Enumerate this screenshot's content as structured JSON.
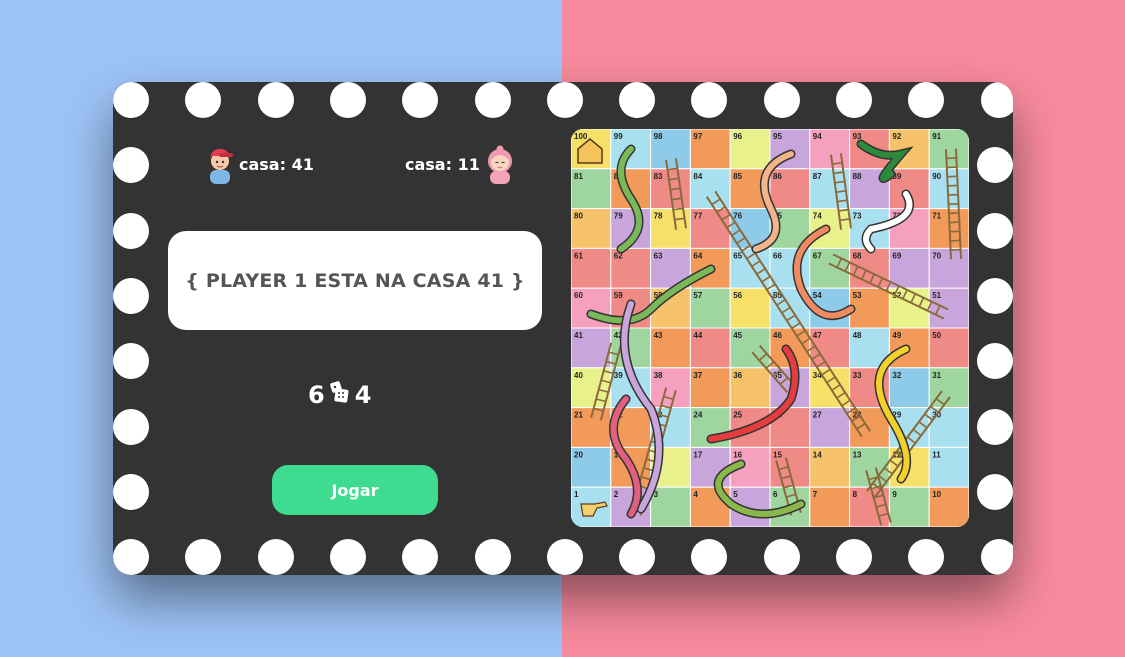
{
  "players": [
    {
      "label": "casa: 41",
      "avatar": "boy-avatar-icon",
      "shirt": "#7fb6e8",
      "cap": "#e53d4f"
    },
    {
      "label": "casa: 11",
      "avatar": "girl-avatar-icon",
      "shirt": "#f3a3b5",
      "hair": "#f09ab0"
    }
  ],
  "status_text": "{ PLAYER 1 ESTA NA CASA 41 }",
  "dice": {
    "left_value": "6",
    "right_value": "4",
    "icon": "dice-icon"
  },
  "play_button_label": "Jogar",
  "colors": {
    "left_background": "#9ec4f7",
    "right_background": "#f98b9e",
    "card": "#333333",
    "button": "#3ddc91"
  },
  "board": {
    "numbers": [
      100,
      99,
      98,
      97,
      96,
      95,
      94,
      93,
      92,
      91,
      81,
      82,
      83,
      84,
      85,
      86,
      87,
      88,
      89,
      90,
      80,
      79,
      78,
      77,
      76,
      75,
      74,
      73,
      72,
      71,
      61,
      62,
      63,
      64,
      65,
      66,
      67,
      68,
      69,
      70,
      60,
      59,
      58,
      57,
      56,
      55,
      54,
      53,
      52,
      51,
      41,
      42,
      43,
      44,
      45,
      46,
      47,
      48,
      49,
      50,
      40,
      39,
      38,
      37,
      36,
      35,
      34,
      33,
      32,
      31,
      21,
      22,
      23,
      24,
      25,
      26,
      27,
      28,
      29,
      30,
      20,
      19,
      18,
      17,
      16,
      15,
      14,
      13,
      12,
      11,
      1,
      2,
      3,
      4,
      5,
      6,
      7,
      8,
      9,
      10
    ],
    "palette": [
      "#f7e06a",
      "#f29a5a",
      "#f6a0c0",
      "#9fd6a0",
      "#8ecbe8",
      "#c8a6dc",
      "#f6c36a",
      "#a8e0f0",
      "#e9f28a",
      "#f08a86"
    ],
    "home_icon": "house-icon",
    "start_icon": "pointing-hand-icon"
  }
}
